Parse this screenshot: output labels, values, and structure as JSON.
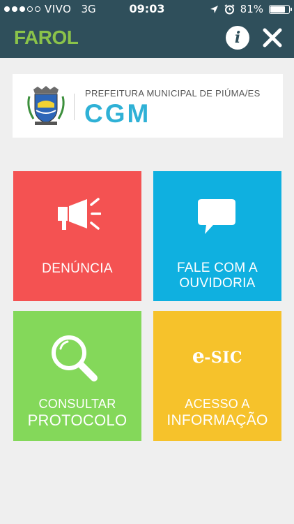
{
  "status_bar": {
    "carrier": "VIVO",
    "network": "3G",
    "time": "09:03",
    "battery_percent": "81%",
    "battery_level": 0.81,
    "signal_bars_filled": 3,
    "signal_bars_total": 5
  },
  "header": {
    "title": "FAROL",
    "info_icon": "info-icon",
    "close_icon": "close-icon"
  },
  "banner": {
    "institution": "PREFEITURA MUNICIPAL DE PIÚMA/ES",
    "acronym": "CGM"
  },
  "tiles": [
    {
      "label": "DENÚNCIA",
      "icon": "megaphone-icon",
      "color": "#f45252"
    },
    {
      "label_line1": "FALE COM A",
      "label_line2": "OUVIDORIA",
      "icon": "speech-bubble-icon",
      "color": "#0fb0e0"
    },
    {
      "label_line1": "CONSULTAR",
      "label_line2": "PROTOCOLO",
      "icon": "magnifier-icon",
      "color": "#84d85a"
    },
    {
      "label_line1": "ACESSO A",
      "label_line2": "INFORMAÇÃO",
      "icon": "esic-logo",
      "logo_e": "e",
      "logo_rest": "-SIC",
      "color": "#f6c22b"
    }
  ],
  "colors": {
    "header_bg": "#2f4f5b",
    "brand_green": "#8bc34a",
    "page_bg": "#efefef"
  }
}
